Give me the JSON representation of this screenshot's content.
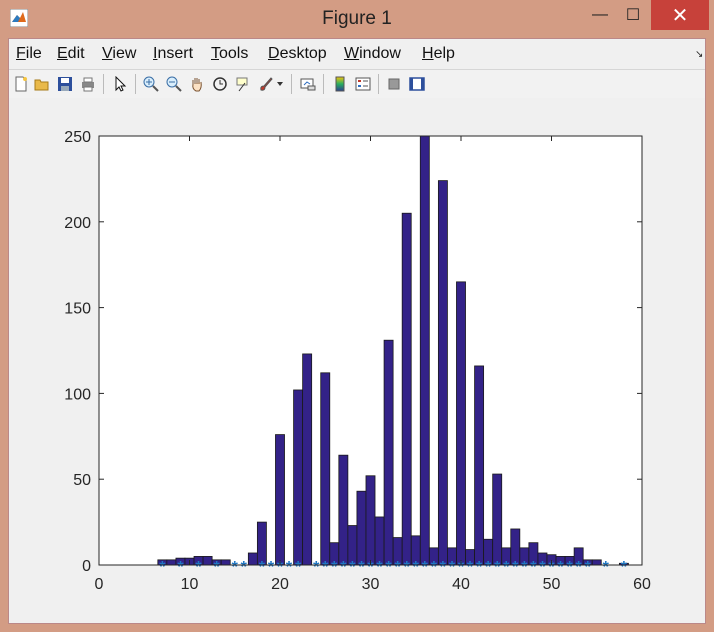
{
  "window": {
    "title": "Figure 1",
    "controls": {
      "minimize": "—",
      "maximize": "☐",
      "close": "✕"
    }
  },
  "menu": [
    {
      "label": "File",
      "u": "F",
      "rest": "ile"
    },
    {
      "label": "Edit",
      "u": "E",
      "rest": "dit"
    },
    {
      "label": "View",
      "u": "V",
      "rest": "iew"
    },
    {
      "label": "Insert",
      "u": "I",
      "rest": "nsert"
    },
    {
      "label": "Tools",
      "u": "T",
      "rest": "ools"
    },
    {
      "label": "Desktop",
      "u": "D",
      "rest": "esktop"
    },
    {
      "label": "Window",
      "u": "W",
      "rest": "indow"
    },
    {
      "label": "Help",
      "u": "H",
      "rest": "elp"
    }
  ],
  "toolbar_icons": [
    "new-figure-icon",
    "open-file-icon",
    "save-icon",
    "print-icon",
    "select-arrow-icon",
    "zoom-in-icon",
    "zoom-out-icon",
    "pan-hand-icon",
    "rotate-3d-icon",
    "data-cursor-icon",
    "brush-icon",
    "brush-dropdown-icon",
    "link-plot-icon",
    "colorbar-icon",
    "legend-icon",
    "hide-plot-tools-icon",
    "show-plot-tools-icon"
  ],
  "colors": {
    "bar_fill": "#332288",
    "bar_edge": "#1a1a1a",
    "marker": "#1f77c4",
    "title_bg": "#d39c84",
    "close_bg": "#c7413a"
  },
  "chart_data": {
    "type": "bar",
    "xlim": [
      0,
      60
    ],
    "ylim": [
      0,
      250
    ],
    "xticks": [
      0,
      10,
      20,
      30,
      40,
      50,
      60
    ],
    "yticks": [
      0,
      50,
      100,
      150,
      200,
      250
    ],
    "bar_width": 1,
    "x": [
      7,
      8,
      9,
      10,
      11,
      12,
      13,
      14,
      15,
      16,
      17,
      18,
      19,
      20,
      21,
      22,
      23,
      24,
      25,
      26,
      27,
      28,
      29,
      30,
      31,
      32,
      33,
      34,
      35,
      36,
      37,
      38,
      39,
      40,
      41,
      42,
      43,
      44,
      45,
      46,
      47,
      48,
      49,
      50,
      51,
      52,
      53,
      54,
      55,
      56,
      57,
      58,
      59
    ],
    "values": [
      3,
      3,
      4,
      4,
      5,
      5,
      3,
      3,
      0,
      0,
      7,
      25,
      0,
      76,
      0,
      102,
      123,
      0,
      112,
      13,
      64,
      23,
      43,
      52,
      28,
      131,
      16,
      205,
      17,
      250,
      10,
      224,
      10,
      165,
      9,
      116,
      15,
      53,
      10,
      21,
      10,
      13,
      7,
      6,
      5,
      5,
      10,
      3,
      3,
      0,
      0,
      1,
      0
    ],
    "markers_x": [
      7,
      9,
      11,
      13,
      15,
      16,
      18,
      19,
      20,
      21,
      22,
      24,
      25,
      26,
      27,
      28,
      29,
      30,
      31,
      32,
      33,
      34,
      35,
      36,
      37,
      38,
      39,
      40,
      41,
      42,
      43,
      44,
      45,
      46,
      47,
      48,
      49,
      50,
      51,
      52,
      53,
      54,
      56,
      58
    ],
    "markers_y": 0,
    "marker_symbol": "*"
  }
}
